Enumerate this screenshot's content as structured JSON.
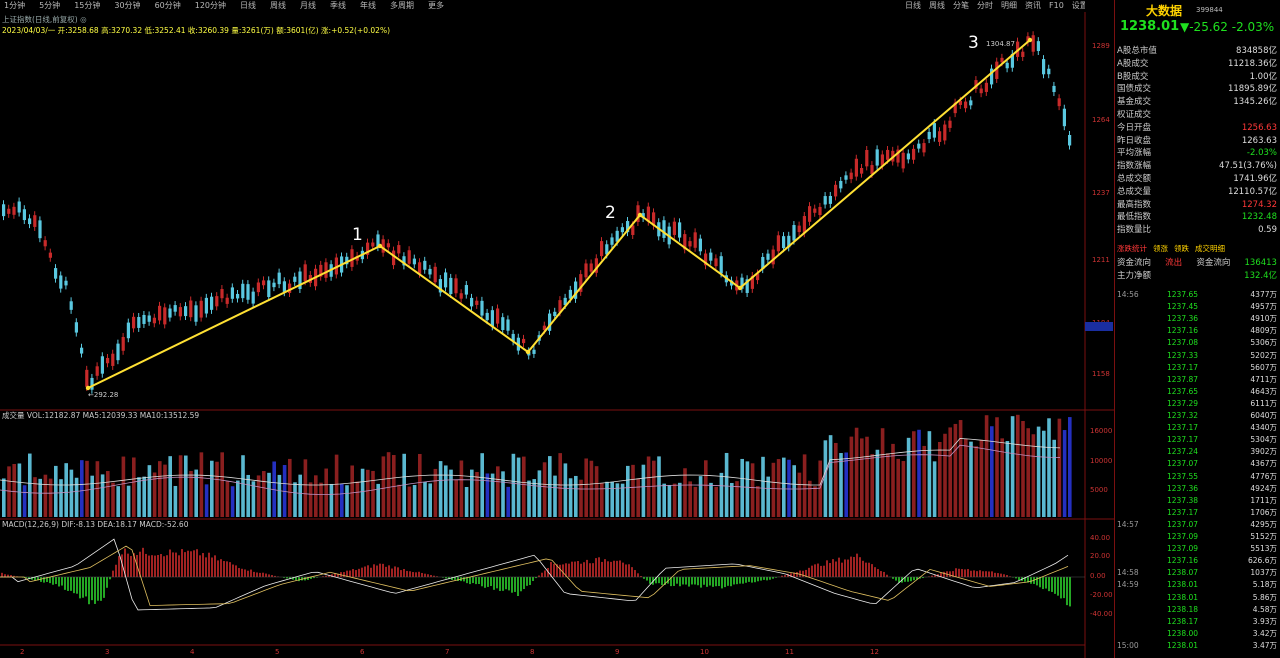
{
  "menu": [
    "1分钟",
    "5分钟",
    "15分钟",
    "30分钟",
    "60分钟",
    "120分钟",
    "日线",
    "周线",
    "月线",
    "季线",
    "年线",
    "多周期",
    "更多"
  ],
  "right_menu": [
    "日线",
    "周线",
    "分笔",
    "分时",
    "明细",
    "资讯",
    "F10",
    "设置"
  ],
  "info_line": "上证指数(日线,前复权) ◎",
  "info_line2": "2023/04/03/一  开:3258.68  高:3270.32  低:3252.41  收:3260.39 量:3261(万)  额:3601(亿)  涨:+0.52(+0.02%)",
  "vol_line": "成交量  VOL:12182.87  MA5:12039.33  MA10:13512.59",
  "macd_line": "MACD(12,26,9)  DIF:-8.13  DEA:18.17  MACD:-52.60",
  "axis_price": [
    "1289",
    "1264",
    "1237",
    "1211",
    "1184",
    "1158"
  ],
  "axis_vol": [
    "16000",
    "10000",
    "5000"
  ],
  "axis_macd": [
    "40.00",
    "20.00",
    "0.00",
    "-20.00",
    "-40.00"
  ],
  "x_ticks": [
    "2",
    "3",
    "4",
    "5",
    "6",
    "7",
    "8",
    "9",
    "10",
    "11",
    "12"
  ],
  "low_label": "←292.28",
  "high_label": "1304.87",
  "wave_labels": [
    "1",
    "2",
    "3"
  ],
  "side": {
    "name": "大数据",
    "code": "399844",
    "price": "1238.01",
    "change": "▼-25.62",
    "change_pct": "-2.03%",
    "rows": [
      {
        "k": "A股总市值",
        "v": "834858亿",
        "c": ""
      },
      {
        "k": "A股成交",
        "v": "11218.36亿",
        "c": ""
      },
      {
        "k": "B股成交",
        "v": "1.00亿",
        "c": ""
      },
      {
        "k": "国债成交",
        "v": "11895.89亿",
        "c": ""
      },
      {
        "k": "基金成交",
        "v": "1345.26亿",
        "c": ""
      },
      {
        "k": "权证成交",
        "v": "",
        "c": ""
      },
      {
        "k": "今日开盘",
        "v": "1256.63",
        "c": "red"
      },
      {
        "k": "昨日收盘",
        "v": "1263.63",
        "c": ""
      },
      {
        "k": "平均涨幅",
        "v": "-2.03%",
        "c": "green"
      },
      {
        "k": "指数涨幅",
        "v": "47.51(3.76%)",
        "c": ""
      },
      {
        "k": "总成交额",
        "v": "1741.96亿",
        "c": ""
      },
      {
        "k": "总成交量",
        "v": "12110.57亿",
        "c": ""
      },
      {
        "k": "最高指数",
        "v": "1274.32",
        "c": "red"
      },
      {
        "k": "最低指数",
        "v": "1232.48",
        "c": "green"
      },
      {
        "k": "指数量比",
        "v": "0.59",
        "c": ""
      }
    ],
    "tabs": [
      "涨跌统计",
      "领涨",
      "领跌",
      "成交明细"
    ],
    "flow1": {
      "k": "资金流向",
      "v": "流出",
      "k2": "资金流向",
      "v2": "136413"
    },
    "flow2": {
      "k": "主力净额",
      "v": "132.4亿"
    },
    "ticks": [
      {
        "t": "14:56",
        "p": "1237.65",
        "v": "4377万"
      },
      {
        "t": "",
        "p": "1237.45",
        "v": "4957万"
      },
      {
        "t": "",
        "p": "1237.36",
        "v": "4910万"
      },
      {
        "t": "",
        "p": "1237.16",
        "v": "4809万"
      },
      {
        "t": "",
        "p": "1237.08",
        "v": "5306万"
      },
      {
        "t": "",
        "p": "1237.33",
        "v": "5202万"
      },
      {
        "t": "",
        "p": "1237.17",
        "v": "5607万"
      },
      {
        "t": "",
        "p": "1237.87",
        "v": "4711万"
      },
      {
        "t": "",
        "p": "1237.65",
        "v": "4643万"
      },
      {
        "t": "",
        "p": "1237.29",
        "v": "6111万"
      },
      {
        "t": "",
        "p": "1237.32",
        "v": "6040万"
      },
      {
        "t": "",
        "p": "1237.17",
        "v": "4340万"
      },
      {
        "t": "",
        "p": "1237.17",
        "v": "5304万"
      },
      {
        "t": "",
        "p": "1237.24",
        "v": "3902万"
      },
      {
        "t": "",
        "p": "1237.07",
        "v": "4367万"
      },
      {
        "t": "",
        "p": "1237.55",
        "v": "4776万"
      },
      {
        "t": "",
        "p": "1237.36",
        "v": "4924万"
      },
      {
        "t": "",
        "p": "1237.38",
        "v": "1711万"
      },
      {
        "t": "",
        "p": "1237.17",
        "v": "1706万"
      },
      {
        "t": "14:57",
        "p": "1237.07",
        "v": "4295万"
      },
      {
        "t": "",
        "p": "1237.09",
        "v": "5152万"
      },
      {
        "t": "",
        "p": "1237.09",
        "v": "5513万"
      },
      {
        "t": "",
        "p": "1237.16",
        "v": "626.6万"
      },
      {
        "t": "14:58",
        "p": "1238.07",
        "v": "1037万"
      },
      {
        "t": "14:59",
        "p": "1238.01",
        "v": "5.18万"
      },
      {
        "t": "",
        "p": "1238.01",
        "v": "5.86万"
      },
      {
        "t": "",
        "p": "1238.18",
        "v": "4.58万"
      },
      {
        "t": "",
        "p": "1238.17",
        "v": "3.93万"
      },
      {
        "t": "",
        "p": "1238.00",
        "v": "3.42万"
      },
      {
        "t": "15:00",
        "p": "1238.01",
        "v": "3.47万"
      }
    ]
  },
  "colors": {
    "up": "#c82a2a",
    "down": "#5ac8e0",
    "wave": "#ffe033",
    "ma1": "#ffffff",
    "ma2": "#e0c080"
  }
}
